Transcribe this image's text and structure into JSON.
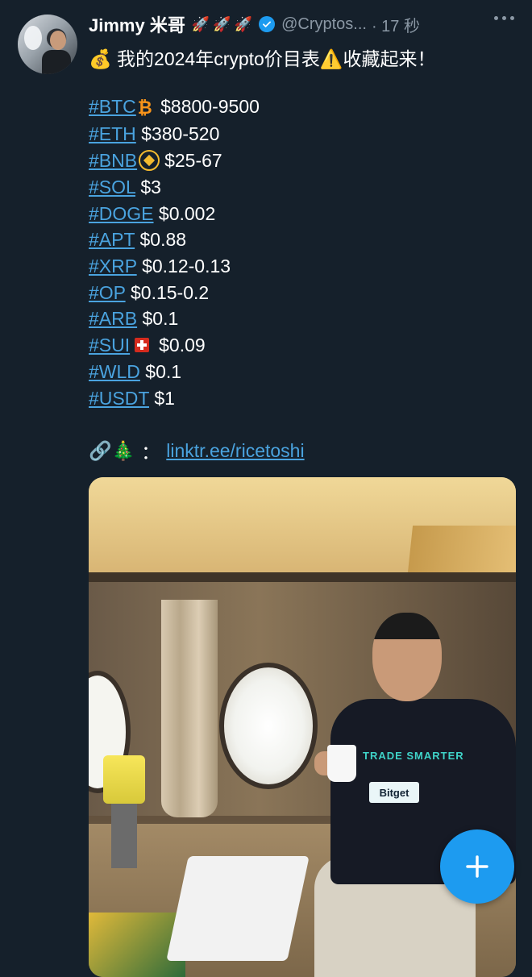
{
  "tweet": {
    "display_name": "Jimmy 米哥",
    "name_emojis": "🚀🚀🚀",
    "handle": "@Cryptos...",
    "time": "· 17 秒",
    "headline_emoji": "💰",
    "headline_text": "我的2024年crypto价目表",
    "warning_emoji": "⚠️",
    "headline_tail": "收藏起来！",
    "prices": [
      {
        "tag": "#BTC",
        "coin_icon": "bitcoin-icon",
        "coin_glyph": "₿",
        "price": "$8800-9500"
      },
      {
        "tag": "#ETH",
        "price": "$380-520"
      },
      {
        "tag": "#BNB",
        "coin_icon": "bnb-icon",
        "price": "$25-67"
      },
      {
        "tag": "#SOL",
        "price": "$3"
      },
      {
        "tag": "#DOGE",
        "price": "$0.002"
      },
      {
        "tag": "#APT",
        "price": "$0.88"
      },
      {
        "tag": "#XRP",
        "price": "$0.12-0.13"
      },
      {
        "tag": "#OP",
        "price": "$0.15-0.2"
      },
      {
        "tag": "#ARB",
        "price": "$0.1"
      },
      {
        "tag": "#SUI",
        "coin_icon": "swiss-flag-icon",
        "price": "$0.09"
      },
      {
        "tag": "#WLD",
        "price": "$0.1"
      },
      {
        "tag": "#USDT",
        "price": "$1"
      }
    ],
    "link_emojis": "🔗🎄",
    "link_colon": "：",
    "link_text": "linktr.ee/ricetoshi",
    "photo": {
      "shirt_text": "TRADE SMARTER",
      "shirt_logo": "Bitget"
    }
  },
  "fab": {
    "icon": "plus-icon"
  },
  "colors": {
    "background": "#15202b",
    "link": "#4aa3df",
    "secondary_text": "#8b98a5",
    "accent": "#1d9bf0"
  }
}
